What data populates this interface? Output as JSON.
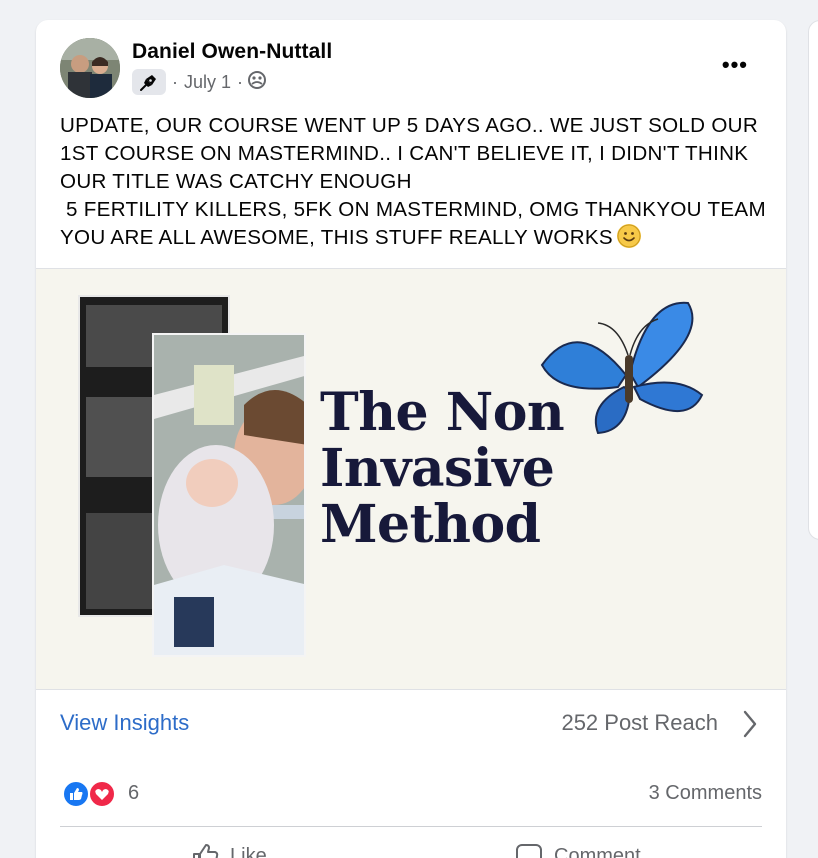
{
  "post": {
    "author": "Daniel Owen-Nuttall",
    "date": "July 1",
    "separator": "·",
    "text": "UPDATE, OUR COURSE WENT UP 5 DAYS AGO.. WE JUST SOLD OUR 1ST COURSE ON MASTERMIND.. I CAN'T BELIEVE IT, I DIDN'T THINK OUR TITLE WAS CATCHY ENOUGH\n 5 FERTILITY KILLERS, 5FK ON MASTERMIND, OMG THANKYOU TEAM YOU ARE ALL AWESOME, THIS STUFF REALLY WORKS",
    "more_label": "•••"
  },
  "media": {
    "headline_line1": "The Non",
    "headline_line2": "Invasive",
    "headline_line3": "Method"
  },
  "insights": {
    "view_label": "View Insights",
    "reach_label": "252 Post Reach"
  },
  "engagement": {
    "reaction_count": "6",
    "comments_label": "3 Comments"
  },
  "actions": {
    "like_label": "Like",
    "comment_label": "Comment"
  },
  "icons": {
    "badge": "pen-nib-icon",
    "audience": "friends-audience-icon",
    "like_reaction": "like-reaction-icon",
    "love_reaction": "love-reaction-icon",
    "chevron": "chevron-right-icon",
    "emoji": "smiley-emoji-icon"
  },
  "colors": {
    "link_blue": "#2d6cc8",
    "secondary_text": "#65676b",
    "headline_navy": "#17193a",
    "like_blue": "#1877f2",
    "love_red": "#f02849"
  }
}
